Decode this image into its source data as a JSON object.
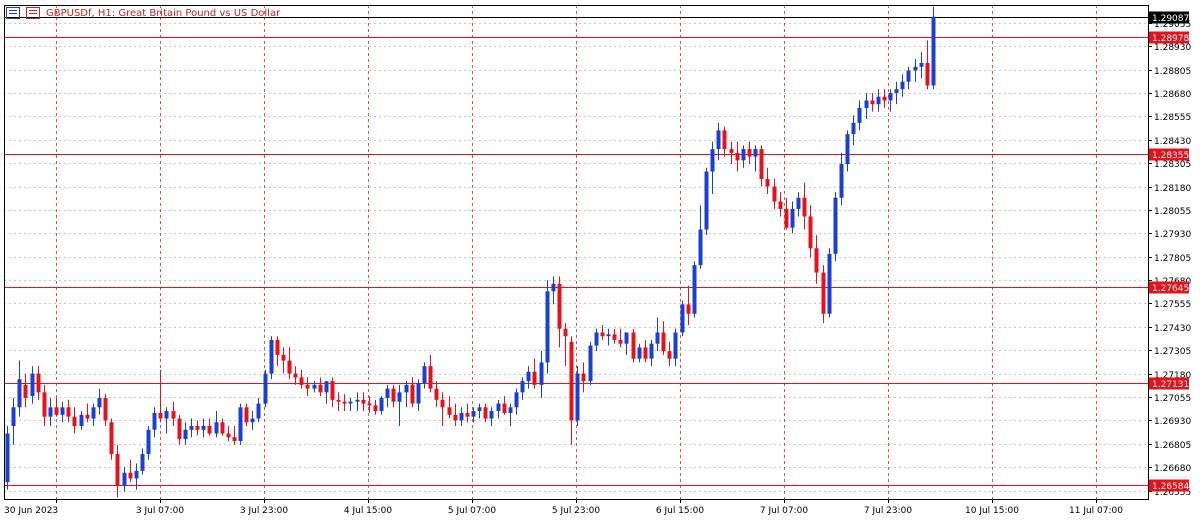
{
  "window": {
    "symbol_title": "GBPUSDf, H1:  Great Britain Pound vs US Dollar"
  },
  "colors": {
    "bull": "#1a3fd6",
    "bear": "#e8111b",
    "grid": "#c9c9c9",
    "axis": "#000000",
    "hline": "#e8111b",
    "vline": "#e8111b",
    "label_text": "#cc2222"
  },
  "chart_data": {
    "type": "candlestick",
    "title": "GBPUSDf, H1:  Great Britain Pound vs US Dollar",
    "ylim": [
      1.2651,
      1.2915
    ],
    "y_ticks": [
      "1.29055",
      "1.28930",
      "1.28805",
      "1.28680",
      "1.28555",
      "1.28430",
      "1.28305",
      "1.28180",
      "1.28055",
      "1.27930",
      "1.27805",
      "1.27680",
      "1.27555",
      "1.27430",
      "1.27305",
      "1.27180",
      "1.27055",
      "1.26930",
      "1.26805",
      "1.26680",
      "1.26555"
    ],
    "x_labels": [
      "30 Jun 2023",
      "3 Jul 07:00",
      "3 Jul 23:00",
      "4 Jul 15:00",
      "5 Jul 07:00",
      "5 Jul 23:00",
      "6 Jul 15:00",
      "7 Jul 07:00",
      "7 Jul 23:00",
      "10 Jul 15:00",
      "11 Jul 07:00"
    ],
    "current_price": "1.29087",
    "horizontal_lines": [
      "1.28978",
      "1.28355",
      "1.27645",
      "1.27131",
      "1.26584"
    ],
    "grid": true,
    "candles": [
      [
        1.266,
        1.269,
        1.2656,
        1.2686
      ],
      [
        1.269,
        1.2705,
        1.268,
        1.27
      ],
      [
        1.27,
        1.2725,
        1.2695,
        1.2715
      ],
      [
        1.2712,
        1.2718,
        1.27,
        1.2705
      ],
      [
        1.2706,
        1.2722,
        1.2702,
        1.2718
      ],
      [
        1.2718,
        1.2722,
        1.2704,
        1.2708
      ],
      [
        1.2708,
        1.2712,
        1.269,
        1.2695
      ],
      [
        1.2695,
        1.2705,
        1.269,
        1.27
      ],
      [
        1.27,
        1.2705,
        1.2695,
        1.2696
      ],
      [
        1.2696,
        1.2703,
        1.2692,
        1.27
      ],
      [
        1.27,
        1.2704,
        1.2692,
        1.2695
      ],
      [
        1.2695,
        1.27,
        1.2686,
        1.269
      ],
      [
        1.269,
        1.2698,
        1.2688,
        1.2696
      ],
      [
        1.2696,
        1.2702,
        1.2692,
        1.2694
      ],
      [
        1.2694,
        1.2702,
        1.269,
        1.27
      ],
      [
        1.27,
        1.271,
        1.2696,
        1.2705
      ],
      [
        1.2705,
        1.2707,
        1.269,
        1.2693
      ],
      [
        1.2692,
        1.2694,
        1.2672,
        1.2675
      ],
      [
        1.2675,
        1.268,
        1.2652,
        1.2658
      ],
      [
        1.2658,
        1.2668,
        1.2655,
        1.2665
      ],
      [
        1.2665,
        1.2672,
        1.266,
        1.2662
      ],
      [
        1.2662,
        1.267,
        1.2656,
        1.2666
      ],
      [
        1.2666,
        1.2678,
        1.2664,
        1.2675
      ],
      [
        1.2675,
        1.269,
        1.2672,
        1.2688
      ],
      [
        1.2688,
        1.27,
        1.2684,
        1.2697
      ],
      [
        1.2697,
        1.272,
        1.2692,
        1.2694
      ],
      [
        1.2694,
        1.27,
        1.2686,
        1.2698
      ],
      [
        1.2698,
        1.2703,
        1.269,
        1.2694
      ],
      [
        1.2694,
        1.2696,
        1.268,
        1.2683
      ],
      [
        1.2683,
        1.2692,
        1.268,
        1.2688
      ],
      [
        1.2688,
        1.2694,
        1.2684,
        1.269
      ],
      [
        1.269,
        1.2693,
        1.2685,
        1.2688
      ],
      [
        1.2688,
        1.2694,
        1.2684,
        1.269
      ],
      [
        1.269,
        1.2694,
        1.2685,
        1.2686
      ],
      [
        1.2686,
        1.2698,
        1.2684,
        1.2692
      ],
      [
        1.2692,
        1.2694,
        1.2685,
        1.2686
      ],
      [
        1.2686,
        1.269,
        1.2682,
        1.2684
      ],
      [
        1.2684,
        1.269,
        1.268,
        1.2682
      ],
      [
        1.2682,
        1.2702,
        1.268,
        1.27
      ],
      [
        1.27,
        1.2702,
        1.269,
        1.2692
      ],
      [
        1.2692,
        1.2698,
        1.2688,
        1.2694
      ],
      [
        1.2694,
        1.2705,
        1.2692,
        1.2702
      ],
      [
        1.2702,
        1.272,
        1.27,
        1.2718
      ],
      [
        1.2718,
        1.2738,
        1.2715,
        1.2736
      ],
      [
        1.2736,
        1.2738,
        1.2722,
        1.2728
      ],
      [
        1.2728,
        1.2732,
        1.2718,
        1.2725
      ],
      [
        1.2725,
        1.2732,
        1.2715,
        1.2718
      ],
      [
        1.2718,
        1.2722,
        1.2712,
        1.2716
      ],
      [
        1.2716,
        1.272,
        1.271,
        1.2712
      ],
      [
        1.2712,
        1.2716,
        1.2706,
        1.271
      ],
      [
        1.271,
        1.2714,
        1.2708,
        1.2712
      ],
      [
        1.2712,
        1.2716,
        1.2706,
        1.2708
      ],
      [
        1.2708,
        1.2712,
        1.2702,
        1.2714
      ],
      [
        1.2714,
        1.2716,
        1.27,
        1.2704
      ],
      [
        1.2704,
        1.2708,
        1.2698,
        1.2703
      ],
      [
        1.2703,
        1.2707,
        1.2698,
        1.2702
      ],
      [
        1.2702,
        1.2705,
        1.2698,
        1.2703
      ],
      [
        1.2703,
        1.2708,
        1.2698,
        1.2704
      ],
      [
        1.2704,
        1.2708,
        1.2698,
        1.2702
      ],
      [
        1.2702,
        1.2706,
        1.2697,
        1.2701
      ],
      [
        1.2701,
        1.2704,
        1.2696,
        1.2698
      ],
      [
        1.2698,
        1.2706,
        1.2696,
        1.2705
      ],
      [
        1.2705,
        1.2712,
        1.27,
        1.271
      ],
      [
        1.271,
        1.2712,
        1.27,
        1.2703
      ],
      [
        1.2703,
        1.2712,
        1.269,
        1.2708
      ],
      [
        1.2708,
        1.2714,
        1.27,
        1.2712
      ],
      [
        1.2712,
        1.2716,
        1.27,
        1.2702
      ],
      [
        1.2702,
        1.2715,
        1.2698,
        1.2713
      ],
      [
        1.2713,
        1.2724,
        1.271,
        1.2722
      ],
      [
        1.2722,
        1.2728,
        1.2708,
        1.271
      ],
      [
        1.271,
        1.2714,
        1.27,
        1.2704
      ],
      [
        1.2704,
        1.2708,
        1.269,
        1.27
      ],
      [
        1.27,
        1.2706,
        1.2694,
        1.2696
      ],
      [
        1.2696,
        1.2702,
        1.269,
        1.2693
      ],
      [
        1.2693,
        1.27,
        1.269,
        1.2697
      ],
      [
        1.2697,
        1.2702,
        1.2692,
        1.2695
      ],
      [
        1.2695,
        1.27,
        1.2692,
        1.2698
      ],
      [
        1.2698,
        1.2702,
        1.2694,
        1.27
      ],
      [
        1.27,
        1.2702,
        1.2692,
        1.2694
      ],
      [
        1.2694,
        1.27,
        1.269,
        1.2698
      ],
      [
        1.2698,
        1.2704,
        1.2694,
        1.2702
      ],
      [
        1.2702,
        1.2706,
        1.2696,
        1.2697
      ],
      [
        1.2697,
        1.2702,
        1.269,
        1.27
      ],
      [
        1.27,
        1.271,
        1.2696,
        1.2708
      ],
      [
        1.2708,
        1.2716,
        1.2704,
        1.2714
      ],
      [
        1.2714,
        1.2722,
        1.271,
        1.2719
      ],
      [
        1.2719,
        1.2726,
        1.271,
        1.2712
      ],
      [
        1.2712,
        1.273,
        1.2705,
        1.2724
      ],
      [
        1.2724,
        1.2768,
        1.2718,
        1.2762
      ],
      [
        1.2762,
        1.277,
        1.2755,
        1.2766
      ],
      [
        1.2766,
        1.277,
        1.2732,
        1.2742
      ],
      [
        1.2742,
        1.2745,
        1.2722,
        1.2738
      ],
      [
        1.2735,
        1.2738,
        1.268,
        1.2693
      ],
      [
        1.2693,
        1.2722,
        1.269,
        1.2718
      ],
      [
        1.2718,
        1.2724,
        1.2708,
        1.2714
      ],
      [
        1.2714,
        1.2735,
        1.2712,
        1.2733
      ],
      [
        1.2733,
        1.2742,
        1.273,
        1.274
      ],
      [
        1.274,
        1.2744,
        1.2736,
        1.2738
      ],
      [
        1.2738,
        1.2742,
        1.2733,
        1.2739
      ],
      [
        1.2739,
        1.2742,
        1.2734,
        1.2736
      ],
      [
        1.2736,
        1.2742,
        1.2732,
        1.2734
      ],
      [
        1.2734,
        1.274,
        1.2728,
        1.274
      ],
      [
        1.274,
        1.2742,
        1.2724,
        1.2726
      ],
      [
        1.2726,
        1.2734,
        1.2724,
        1.2732
      ],
      [
        1.2732,
        1.2736,
        1.2724,
        1.2726
      ],
      [
        1.2726,
        1.2736,
        1.2722,
        1.2734
      ],
      [
        1.2734,
        1.2748,
        1.273,
        1.274
      ],
      [
        1.274,
        1.2746,
        1.2728,
        1.273
      ],
      [
        1.273,
        1.2735,
        1.2722,
        1.2726
      ],
      [
        1.2726,
        1.2742,
        1.2722,
        1.274
      ],
      [
        1.274,
        1.2757,
        1.2738,
        1.2755
      ],
      [
        1.2755,
        1.2765,
        1.2744,
        1.275
      ],
      [
        1.275,
        1.2778,
        1.2748,
        1.2776
      ],
      [
        1.2776,
        1.2808,
        1.2774,
        1.2795
      ],
      [
        1.2795,
        1.2828,
        1.2792,
        1.2826
      ],
      [
        1.2826,
        1.2842,
        1.2814,
        1.2838
      ],
      [
        1.2838,
        1.2852,
        1.2832,
        1.2848
      ],
      [
        1.2848,
        1.285,
        1.2834,
        1.2838
      ],
      [
        1.2838,
        1.2842,
        1.283,
        1.2836
      ],
      [
        1.2836,
        1.2842,
        1.2826,
        1.2832
      ],
      [
        1.2832,
        1.284,
        1.2828,
        1.2838
      ],
      [
        1.2838,
        1.2842,
        1.283,
        1.2834
      ],
      [
        1.2834,
        1.284,
        1.2826,
        1.2838
      ],
      [
        1.2838,
        1.284,
        1.2818,
        1.2822
      ],
      [
        1.2822,
        1.2828,
        1.2814,
        1.2818
      ],
      [
        1.2818,
        1.2822,
        1.2806,
        1.281
      ],
      [
        1.281,
        1.2815,
        1.2802,
        1.2806
      ],
      [
        1.2806,
        1.2812,
        1.2795,
        1.2796
      ],
      [
        1.2796,
        1.281,
        1.2793,
        1.2806
      ],
      [
        1.2806,
        1.2815,
        1.2802,
        1.2812
      ],
      [
        1.2812,
        1.282,
        1.2795,
        1.2802
      ],
      [
        1.2802,
        1.2808,
        1.278,
        1.2785
      ],
      [
        1.2785,
        1.2792,
        1.2766,
        1.2772
      ],
      [
        1.2772,
        1.2776,
        1.2745,
        1.275
      ],
      [
        1.275,
        1.2785,
        1.2748,
        1.2782
      ],
      [
        1.2782,
        1.2815,
        1.2778,
        1.2812
      ],
      [
        1.2812,
        1.2836,
        1.2808,
        1.283
      ],
      [
        1.283,
        1.2848,
        1.2826,
        1.2846
      ],
      [
        1.2846,
        1.2856,
        1.284,
        1.2852
      ],
      [
        1.2852,
        1.2864,
        1.2848,
        1.286
      ],
      [
        1.286,
        1.2868,
        1.2854,
        1.2864
      ],
      [
        1.2864,
        1.2868,
        1.2858,
        1.2862
      ],
      [
        1.2862,
        1.287,
        1.2858,
        1.2866
      ],
      [
        1.2866,
        1.287,
        1.286,
        1.2864
      ],
      [
        1.2864,
        1.287,
        1.2858,
        1.2868
      ],
      [
        1.2868,
        1.2874,
        1.2862,
        1.287
      ],
      [
        1.287,
        1.2878,
        1.2866,
        1.2874
      ],
      [
        1.2874,
        1.2882,
        1.287,
        1.288
      ],
      [
        1.288,
        1.2886,
        1.2874,
        1.2882
      ],
      [
        1.2882,
        1.289,
        1.2876,
        1.2884
      ],
      [
        1.2884,
        1.2896,
        1.287,
        1.2872
      ],
      [
        1.2872,
        1.2914,
        1.287,
        1.29087
      ]
    ]
  }
}
